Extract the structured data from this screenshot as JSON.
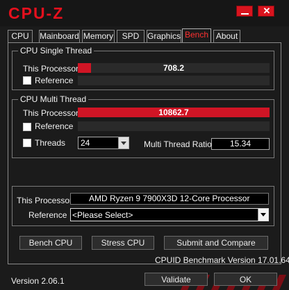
{
  "app": {
    "title": "CPU-Z"
  },
  "window": {
    "minimize_icon": "minimize-icon",
    "close_icon": "close-icon",
    "close_glyph": "✕"
  },
  "tabs": [
    {
      "label": "CPU"
    },
    {
      "label": "Mainboard"
    },
    {
      "label": "Memory"
    },
    {
      "label": "SPD"
    },
    {
      "label": "Graphics"
    },
    {
      "label": "Bench",
      "active": true
    },
    {
      "label": "About"
    }
  ],
  "single_thread": {
    "title": "CPU Single Thread",
    "this_label": "This Processor",
    "this_value": "708.2",
    "this_fill_fraction": 0.07,
    "ref_label": "Reference"
  },
  "multi_thread": {
    "title": "CPU Multi Thread",
    "this_label": "This Processor",
    "this_value": "10862.7",
    "this_fill_fraction": 1.0,
    "ref_label": "Reference",
    "threads_label": "Threads",
    "threads_value": "24",
    "ratio_label": "Multi Thread Ratio",
    "ratio_value": "15.34"
  },
  "compare": {
    "this_label": "This Processor",
    "this_value": "AMD Ryzen 9 7900X3D 12-Core Processor",
    "ref_label": "Reference",
    "ref_value": "<Please Select>"
  },
  "buttons": {
    "bench": "Bench CPU",
    "stress": "Stress CPU",
    "submit": "Submit and Compare",
    "validate": "Validate",
    "ok": "OK"
  },
  "benchmark_version": "CPUID Benchmark Version 17.01.64",
  "footer": {
    "version": "Version 2.06.1"
  },
  "colors": {
    "accent": "#d01525",
    "background": "#1b1b1b"
  }
}
